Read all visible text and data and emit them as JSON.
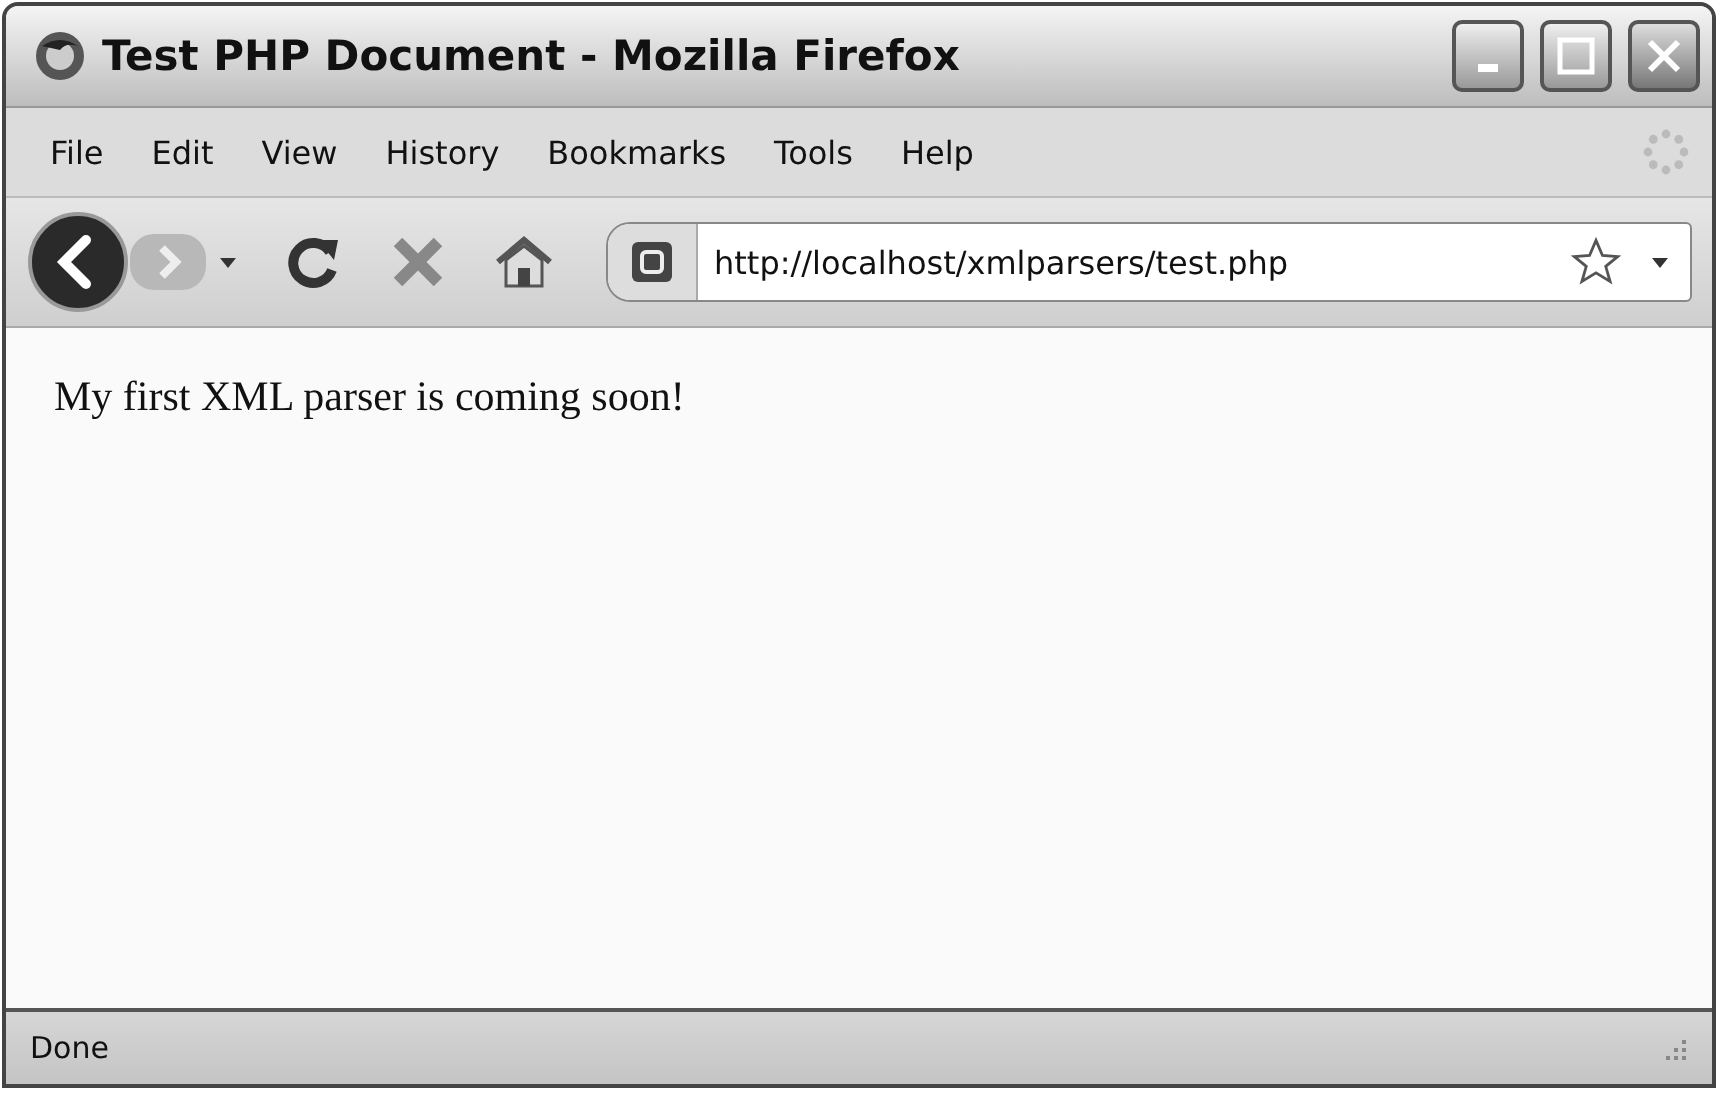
{
  "window": {
    "title": "Test PHP Document - Mozilla Firefox"
  },
  "menu": [
    "File",
    "Edit",
    "View",
    "History",
    "Bookmarks",
    "Tools",
    "Help"
  ],
  "address_bar": {
    "value": "http://localhost/xmlparsers/test.php"
  },
  "content": {
    "text": "My first XML parser is coming soon!"
  },
  "status_bar": {
    "text": "Done"
  }
}
